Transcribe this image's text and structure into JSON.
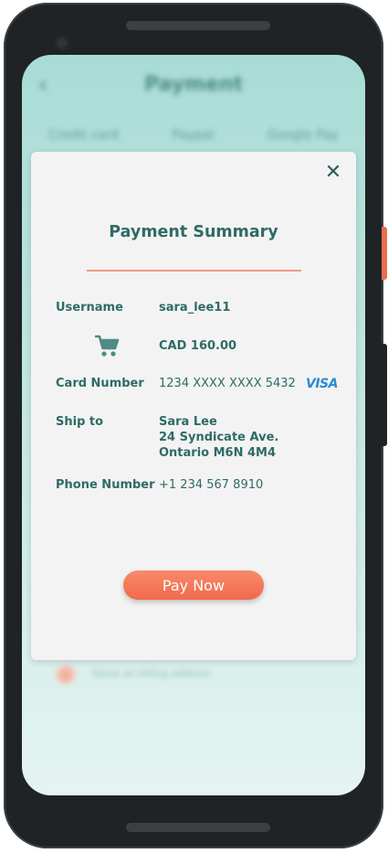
{
  "background": {
    "title": "Payment",
    "back_icon": "chevron-left-icon",
    "tabs": [
      {
        "label": "Credit card"
      },
      {
        "label": "Paypal"
      },
      {
        "label": "Google Pay"
      }
    ],
    "billing_option": "Same as billing address"
  },
  "modal": {
    "title": "Payment Summary",
    "close_icon": "x",
    "username_label": "Username",
    "username_value": "sara_lee11",
    "cart_icon": "cart-icon",
    "amount": "CAD 160.00",
    "card_label": "Card Number",
    "card_value": "1234 XXXX XXXX 5432",
    "card_brand": "VISA",
    "ship_label": "Ship to",
    "ship_line1": "Sara Lee",
    "ship_line2": "24 Syndicate Ave.",
    "ship_line3": "Ontario M6N 4M4",
    "phone_label": "Phone Number",
    "phone_value": "+1 234 567 8910",
    "pay_button": "Pay Now"
  },
  "colors": {
    "accent": "#f06a4c",
    "text": "#2f6b66",
    "visa": "#2a8ad0",
    "screen_bg": "#a9dcd6"
  }
}
